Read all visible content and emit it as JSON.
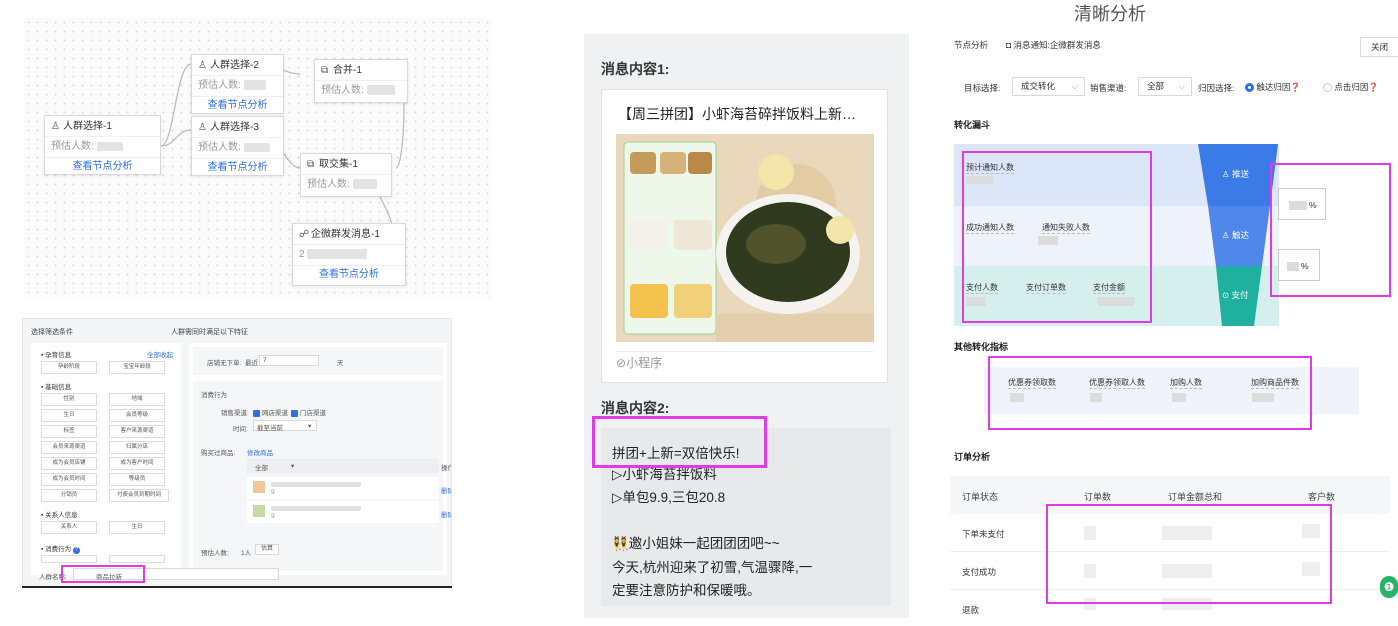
{
  "flow": {
    "nodes": [
      {
        "id": "select1",
        "icon": "user-icon",
        "title": "人群选择-1",
        "est_label": "预估人数:",
        "link": "查看节点分析"
      },
      {
        "id": "select2",
        "icon": "user-icon",
        "title": "人群选择-2",
        "est_label": "预估人数:",
        "link": "查看节点分析"
      },
      {
        "id": "select3",
        "icon": "user-icon",
        "title": "人群选择-3",
        "est_label": "预估人数:",
        "link": "查看节点分析"
      },
      {
        "id": "merge1",
        "icon": "merge-icon",
        "title": "合并-1",
        "est_label": "预估人数:"
      },
      {
        "id": "intersect1",
        "icon": "intersect-icon",
        "title": "取交集-1",
        "est_label": "预估人数:"
      },
      {
        "id": "wecom1",
        "icon": "chat-icon",
        "title": "企微群发消息-1",
        "est_label": "2",
        "link": "查看节点分析"
      }
    ]
  },
  "filter": {
    "left_header": "选择筛选条件",
    "right_header": "人群需同时满足以下特征",
    "categories": [
      {
        "label": "孕育信息",
        "action": "全部收起",
        "chips": [
          "孕龄阶段",
          "宝宝年龄段"
        ]
      },
      {
        "label": "基础信息",
        "chips": [
          "性别",
          "地域",
          "生日",
          "会员等级",
          "标签",
          "客户来源渠道",
          "会员来源渠道",
          "归属分店",
          "成为会员店铺",
          "成为客户时间",
          "成为会员时间",
          "等级员",
          "分销员",
          "付费会员到期时间"
        ]
      },
      {
        "label": "关系人信息",
        "chips": [
          "关系人",
          "生日"
        ]
      },
      {
        "label": "消费行为"
      }
    ],
    "condition1": {
      "label": "店铺无下单:",
      "prefix": "最近",
      "value": "7",
      "unit": "天"
    },
    "consume_title": "消费行为",
    "channel": {
      "label": "销售渠道:",
      "opt1": "网店渠道",
      "opt2": "门店渠道"
    },
    "time": {
      "label": "时间:",
      "value": "截至当前"
    },
    "purchased": {
      "label": "购买过商品:",
      "link": "修改商品"
    },
    "table": {
      "col1": "全部",
      "col_op": "操作",
      "row_op": "删除",
      "sub": "9"
    },
    "estimate": {
      "label": "预估人数:",
      "suffix": "1人",
      "button": "估算"
    },
    "name": {
      "label": "人群名称:",
      "value": "商品拉新"
    }
  },
  "message": {
    "label1": "消息内容1:",
    "card_title": "【周三拼团】小虾海苔碎拌饭料上新…",
    "mini_program": "小程序",
    "label2": "消息内容2:",
    "lines": [
      "拼团+上新=双倍快乐!",
      "▷小虾海苔拌饭料",
      "▷单包9.9,三包20.8",
      "",
      "👯邀小姐妹一起团团团吧~~",
      "今天,杭州迎来了初雪,气温骤降,一",
      "定要注意防护和保暖哦。"
    ]
  },
  "analysis": {
    "caption": "清晰分析",
    "breadcrumb": "节点分析",
    "msg_notice": "消息通知:企微群发消息",
    "close": "关闭",
    "target_label": "目标选择:",
    "target_value": "成交转化",
    "channel_label": "销售渠道:",
    "channel_value": "全部",
    "attr_label": "归因选择:",
    "attr_opt1": "触达归因",
    "attr_opt2": "点击归因",
    "funnel_title": "转化漏斗",
    "funnel": {
      "row1": [
        "预计通知人数"
      ],
      "row2": [
        "成功通知人数",
        "通知失败人数"
      ],
      "row3": [
        "支付人数",
        "支付订单数",
        "支付金额"
      ],
      "stages": [
        "推送",
        "触达",
        "支付"
      ],
      "rates": [
        "%",
        "%"
      ]
    },
    "other_title": "其他转化指标",
    "other_metrics": [
      "优惠券领取数",
      "优惠券领取人数",
      "加购人数",
      "加购商品件数"
    ],
    "order_title": "订单分析",
    "order_headers": [
      "订单状态",
      "订单数",
      "订单金额总和",
      "客户数"
    ],
    "order_rows": [
      "下单未支付",
      "支付成功",
      "退款"
    ]
  },
  "colors": {
    "highlight": "#e13be6",
    "link": "#2f6fe4",
    "funnel_blue": "#3a7be8",
    "funnel_teal": "#1fb0a0"
  }
}
